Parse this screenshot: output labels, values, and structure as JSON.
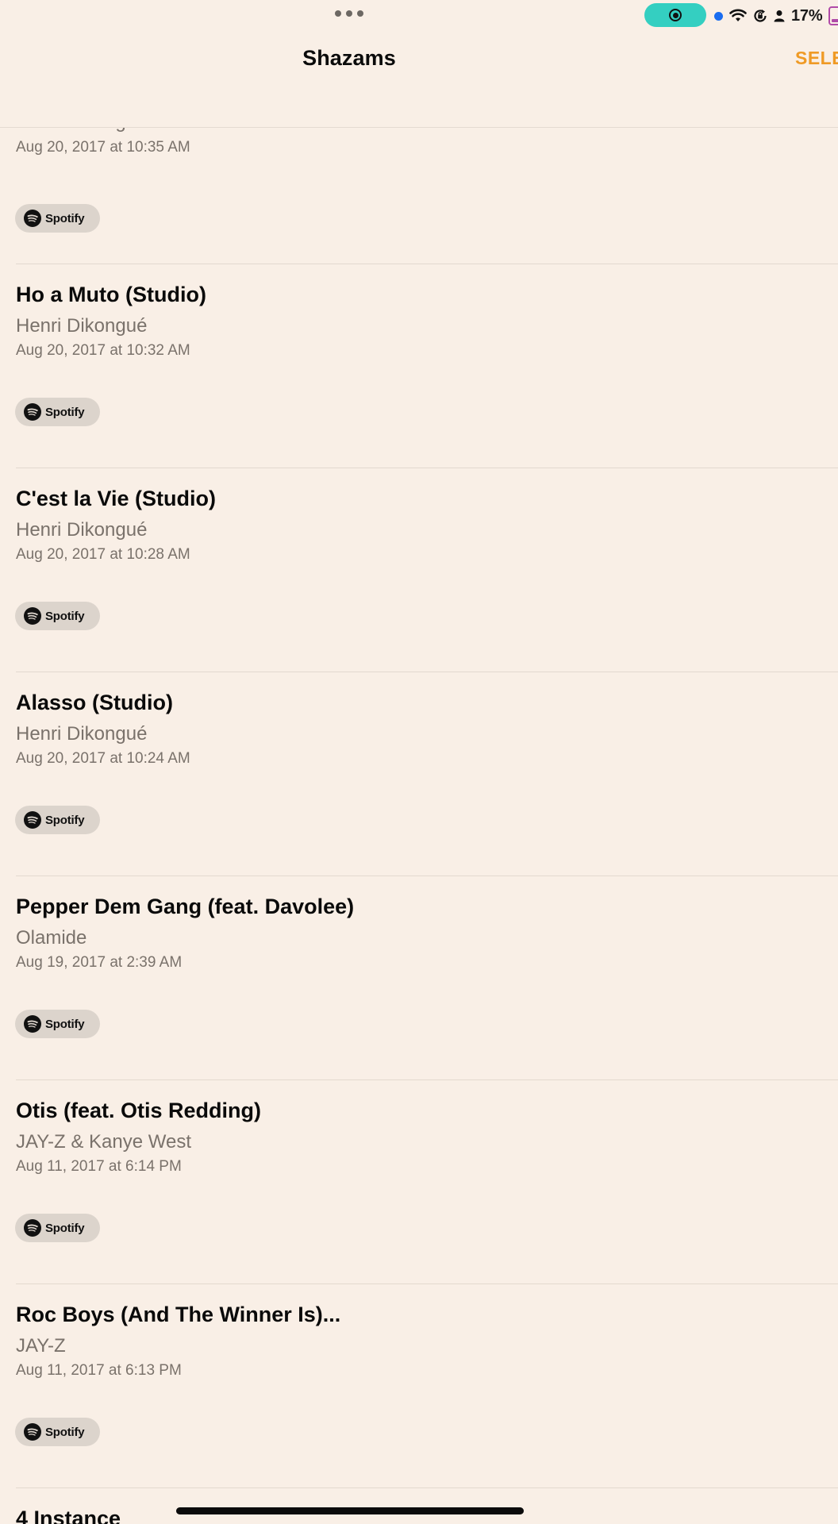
{
  "status_bar": {
    "battery_percent": "17%",
    "icons": [
      "more-dots-icon",
      "screen-record-icon",
      "location-dot-icon",
      "wifi-icon",
      "screen-rotation-lock-icon",
      "person-icon",
      "battery-icon"
    ]
  },
  "nav": {
    "title": "Shazams",
    "select_label": "SELE"
  },
  "partial_item": {
    "artist": "Henri Dikongué",
    "date": "Aug 20, 2017 at 10:35 AM",
    "service": "Spotify"
  },
  "items": [
    {
      "title": "Ho a Muto (Studio)",
      "artist": "Henri Dikongué",
      "date": "Aug 20, 2017 at 10:32 AM",
      "service": "Spotify"
    },
    {
      "title": "C'est la Vie (Studio)",
      "artist": "Henri Dikongué",
      "date": "Aug 20, 2017 at 10:28 AM",
      "service": "Spotify"
    },
    {
      "title": "Alasso (Studio)",
      "artist": "Henri Dikongué",
      "date": "Aug 20, 2017 at 10:24 AM",
      "service": "Spotify"
    },
    {
      "title": "Pepper Dem Gang (feat. Davolee)",
      "artist": "Olamide",
      "date": "Aug 19, 2017 at 2:39 AM",
      "service": "Spotify"
    },
    {
      "title": "Otis (feat. Otis Redding)",
      "artist": "JAY-Z & Kanye West",
      "date": "Aug 11, 2017 at 6:14 PM",
      "service": "Spotify"
    },
    {
      "title": "Roc Boys (And The Winner Is)...",
      "artist": "JAY-Z",
      "date": "Aug 11, 2017 at 6:13 PM",
      "service": "Spotify"
    },
    {
      "title": "4 Instance",
      "artist": "",
      "date": "",
      "service": ""
    }
  ],
  "colors": {
    "background": "#f9efe6",
    "accent": "#ef9a25",
    "secondary_text": "#7a726b",
    "record_pill": "#34cfc1"
  }
}
